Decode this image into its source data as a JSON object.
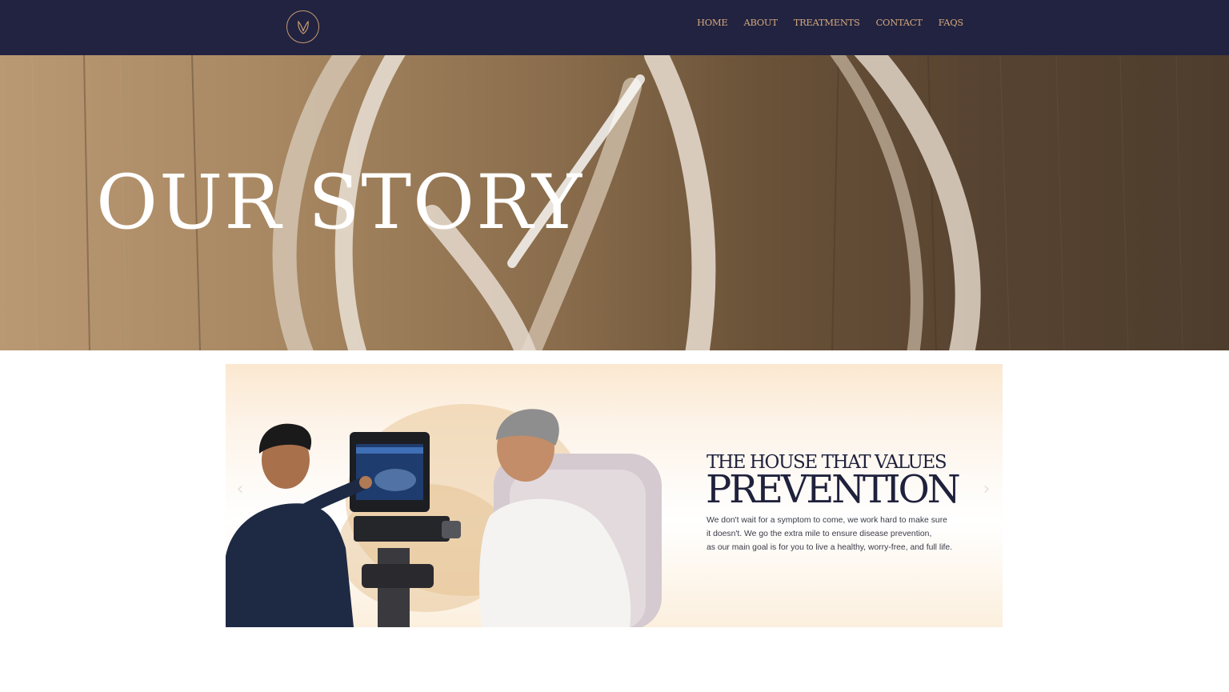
{
  "nav": {
    "logo_icon": "leaf-monogram-icon",
    "links": [
      "HOME",
      "ABOUT",
      "TREATMENTS",
      "CONTACT",
      "FAQS"
    ]
  },
  "hero": {
    "title": "OUR STORY"
  },
  "banner": {
    "kicker": "THE HOUSE THAT VALUES",
    "title": "PREVENTION",
    "body_lines": [
      "We don't wait for a symptom to come, we work hard to make sure",
      "it doesn't. We go the extra mile to ensure disease prevention,",
      "as our main goal is for you to live a healthy, worry-free, and full life."
    ],
    "prev_icon": "chevron-left-icon",
    "next_icon": "chevron-right-icon"
  },
  "colors": {
    "nav_bg": "#212340",
    "nav_text": "#d6a77d",
    "heading": "#1f213c"
  }
}
